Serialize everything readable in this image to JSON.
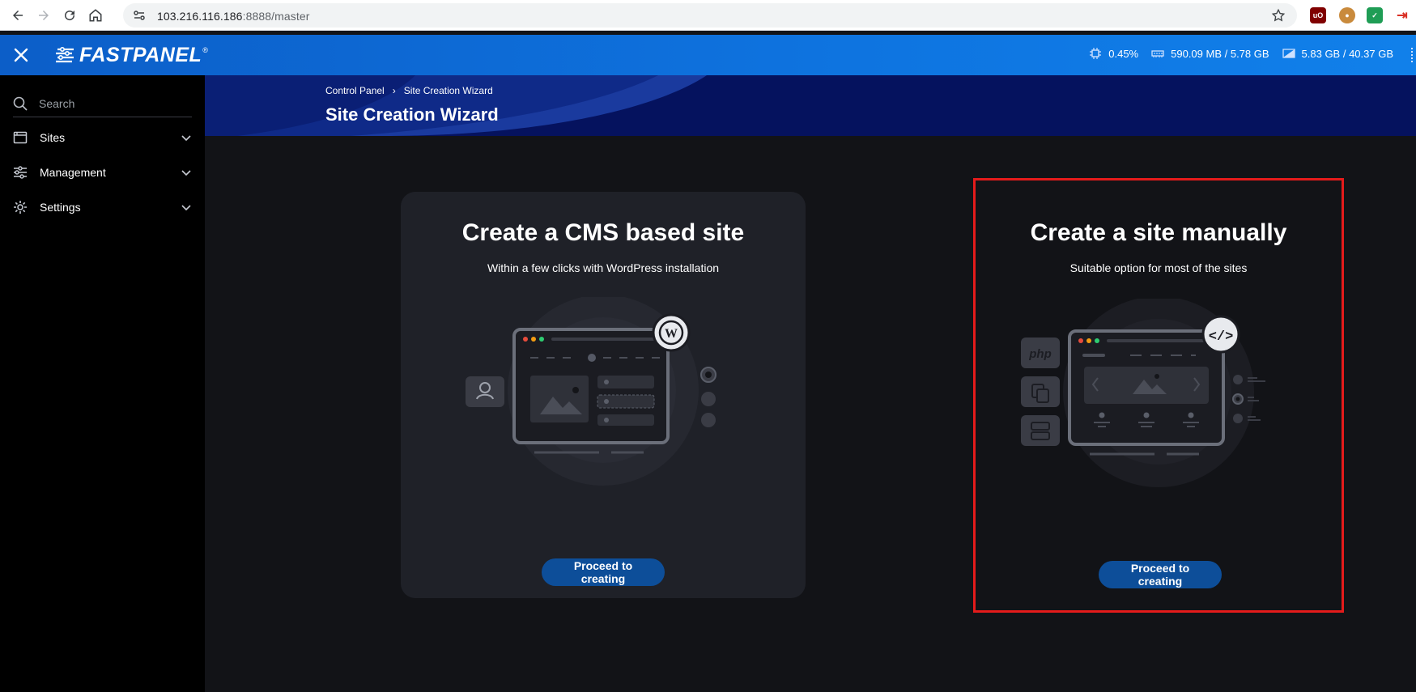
{
  "browser": {
    "url_host": "103.216.116.186",
    "url_rest": ":8888/master"
  },
  "header": {
    "logo_text": "FASTPANEL",
    "logo_reg": "®",
    "cpu": "0.45%",
    "ram": "590.09 MB / 5.78 GB",
    "disk": "5.83 GB / 40.37 GB"
  },
  "sidebar": {
    "search_placeholder": "Search",
    "items": [
      {
        "label": "Sites",
        "icon": "window-icon"
      },
      {
        "label": "Management",
        "icon": "sliders-icon"
      },
      {
        "label": "Settings",
        "icon": "gear-icon"
      }
    ]
  },
  "page": {
    "breadcrumb": [
      "Control Panel",
      "Site Creation Wizard"
    ],
    "title": "Site Creation Wizard"
  },
  "cards": {
    "cms": {
      "title": "Create a CMS based site",
      "subtitle": "Within a few clicks with WordPress installation",
      "button": "Proceed to creating"
    },
    "manual": {
      "title": "Create a site manually",
      "subtitle": "Suitable option for most of the sites",
      "button": "Proceed to creating",
      "php_label": "php"
    }
  },
  "colors": {
    "header_blue": "#0e74e0",
    "banner_navy": "#06166a",
    "button_blue": "#0d4e99",
    "highlight_red": "#e41b1b",
    "card_bg": "#1f2128"
  }
}
